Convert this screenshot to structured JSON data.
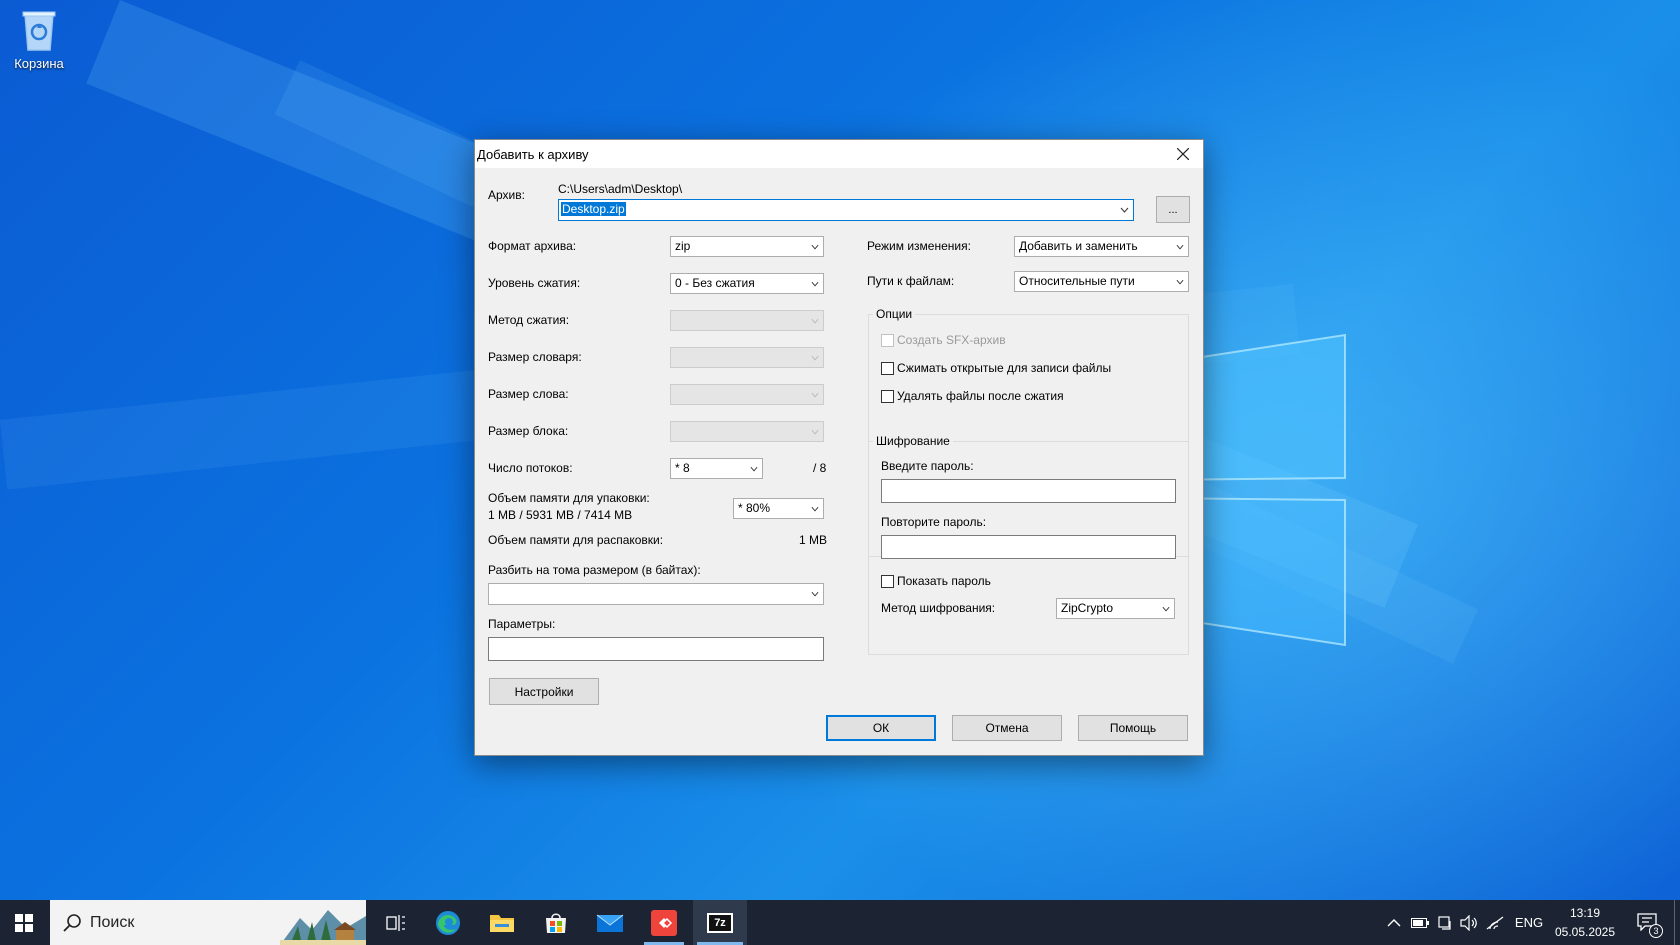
{
  "desktop": {
    "recycle_bin_label": "Корзина"
  },
  "dialog": {
    "title": "Добавить к архиву",
    "archive_label": "Архив:",
    "archive_path": "C:\\Users\\adm\\Desktop\\",
    "archive_name": "Desktop.zip",
    "browse_label": "...",
    "format_label": "Формат архива:",
    "format_value": "zip",
    "level_label": "Уровень сжатия:",
    "level_value": "0 - Без сжатия",
    "method_label": "Метод сжатия:",
    "dict_label": "Размер словаря:",
    "word_label": "Размер слова:",
    "block_label": "Размер блока:",
    "threads_label": "Число потоков:",
    "threads_value": "* 8",
    "threads_max": "/ 8",
    "mem_pack_label": "Объем памяти для упаковки:",
    "mem_pack_info": "1 MB / 5931 MB / 7414 MB",
    "mem_pack_value": "* 80%",
    "mem_unpack_label": "Объем памяти для распаковки:",
    "mem_unpack_value": "1 MB",
    "split_label": "Разбить на тома размером (в байтах):",
    "params_label": "Параметры:",
    "settings_button": "Настройки",
    "update_mode_label": "Режим изменения:",
    "update_mode_value": "Добавить и заменить",
    "paths_label": "Пути к файлам:",
    "paths_value": "Относительные пути",
    "options_title": "Опции",
    "opt_sfx": "Создать SFX-архив",
    "opt_shared": "Сжимать открытые для записи файлы",
    "opt_delete": "Удалять файлы после сжатия",
    "encryption_title": "Шифрование",
    "password_label": "Введите пароль:",
    "password_repeat_label": "Повторите пароль:",
    "show_password": "Показать пароль",
    "enc_method_label": "Метод шифрования:",
    "enc_method_value": "ZipCrypto",
    "ok_button": "ОК",
    "cancel_button": "Отмена",
    "help_button": "Помощь"
  },
  "taskbar": {
    "search_placeholder": "Поиск",
    "language": "ENG",
    "time": "13:19",
    "date": "05.05.2025",
    "notifications_count": "3",
    "app_7zip_label": "7z"
  }
}
